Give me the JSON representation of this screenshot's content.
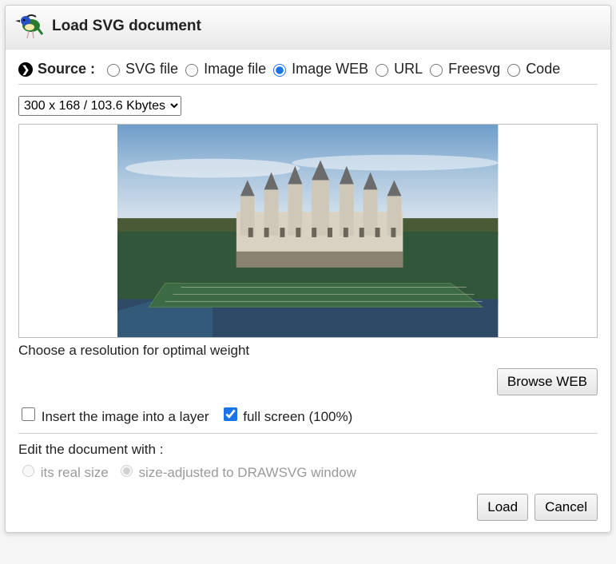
{
  "dialog": {
    "title": "Load SVG document"
  },
  "source": {
    "label": "Source :",
    "options": {
      "svg_file": "SVG file",
      "image_file": "Image file",
      "image_web": "Image WEB",
      "url": "URL",
      "freesvg": "Freesvg",
      "code": "Code"
    },
    "selected": "image_web"
  },
  "resolution": {
    "selected": "300 x 168 / 103.6 Kbytes"
  },
  "hint": "Choose a resolution for optimal weight",
  "browse_button": "Browse WEB",
  "checkboxes": {
    "insert_layer": {
      "label": "Insert the image into a layer",
      "checked": false
    },
    "full_screen": {
      "label": "full screen (100%)",
      "checked": true
    }
  },
  "edit_with": {
    "label": "Edit the document with :",
    "real_size": "its real size",
    "adjusted": "size-adjusted to DRAWSVG window",
    "selected": "adjusted",
    "disabled": true
  },
  "footer": {
    "load": "Load",
    "cancel": "Cancel"
  }
}
